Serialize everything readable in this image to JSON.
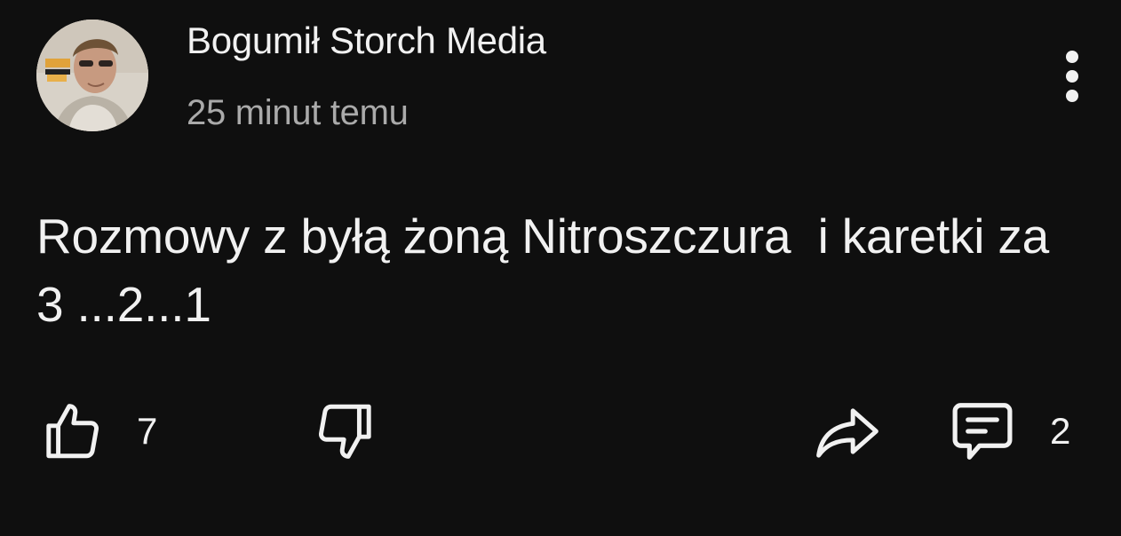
{
  "post": {
    "author": "Bogumił Storch Media",
    "time": "25 minut temu",
    "text": "Rozmowy z byłą żoną Nitroszczura  i karetki za 3 ...2...1",
    "likes": "7",
    "comments": "2"
  },
  "icons": {
    "menu": "more-vertical-icon",
    "like": "thumbs-up-icon",
    "dislike": "thumbs-down-icon",
    "share": "share-arrow-icon",
    "comment": "comment-bubble-icon"
  },
  "colors": {
    "background": "#0f0f0f",
    "text": "#f1f1f1",
    "secondary_text": "#aaaaaa"
  }
}
